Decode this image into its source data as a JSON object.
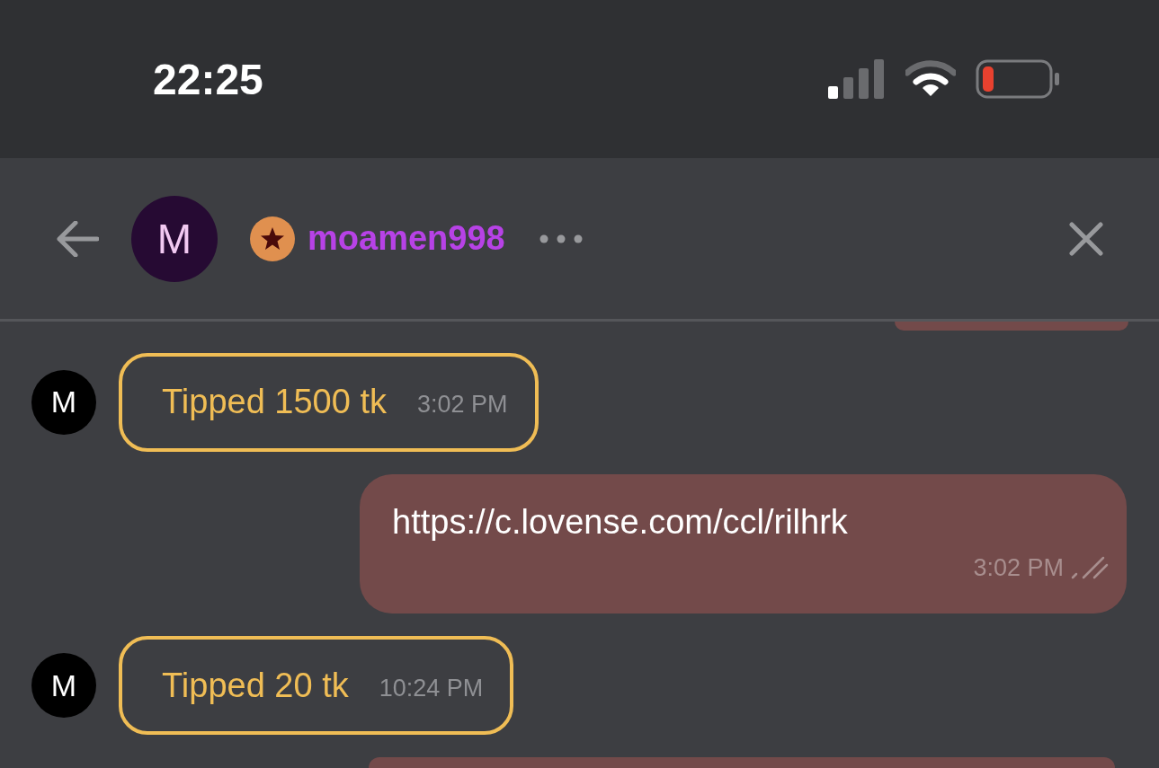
{
  "status_bar": {
    "time": "22:25"
  },
  "header": {
    "avatar_letter": "M",
    "username": "moamen998"
  },
  "messages": [
    {
      "kind": "partial_top"
    },
    {
      "kind": "tip",
      "avatar_letter": "M",
      "text": "Tipped 1500 tk",
      "time": "3:02 PM"
    },
    {
      "kind": "sent",
      "text": "https://c.lovense.com/ccl/rilhrk",
      "time": "3:02 PM",
      "read": true
    },
    {
      "kind": "tip",
      "avatar_letter": "M",
      "text": "Tipped 20 tk",
      "time": "10:24 PM"
    },
    {
      "kind": "partial_bottom"
    }
  ]
}
